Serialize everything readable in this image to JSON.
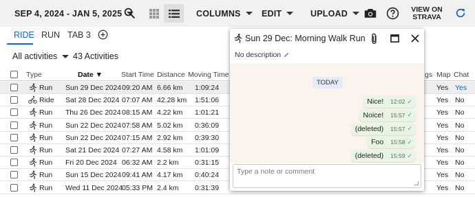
{
  "toolbar": {
    "date_range": "SEP 4, 2024 - JAN 5, 2025",
    "columns_label": "COLUMNS",
    "edit_label": "EDIT",
    "upload_label": "UPLOAD",
    "strava_line1": "VIEW ON",
    "strava_line2": "STRAVA"
  },
  "tabs": [
    "RIDE",
    "RUN",
    "TAB 3"
  ],
  "filter": {
    "activities_select": "All activities",
    "count_text": "43 Activities"
  },
  "table": {
    "headers": {
      "type": "Type",
      "date": "Date ▼",
      "start_time": "Start Time",
      "distance": "Distance",
      "moving_time": "Moving Time",
      "tags": "gs",
      "map": "Map",
      "chat": "Chat"
    },
    "rows": [
      {
        "type": "Run",
        "date": "Sun 29 Dec 2024",
        "start": "09:20 AM",
        "distance": "6.66 km",
        "moving": "1:09:24",
        "map": "Yes",
        "chat": "Yes"
      },
      {
        "type": "Ride",
        "date": "Sat 28 Dec 2024",
        "start": "07:07 AM",
        "distance": "42.28 km",
        "moving": "1:51:06",
        "map": "Yes",
        "chat": "No"
      },
      {
        "type": "Run",
        "date": "Thu 26 Dec 2024",
        "start": "08:15 AM",
        "distance": "4.22 km",
        "moving": "1:01:21",
        "map": "Yes",
        "chat": "No"
      },
      {
        "type": "Run",
        "date": "Sun 22 Dec 2024",
        "start": "07:58 AM",
        "distance": "5.02 km",
        "moving": "0:36:09",
        "map": "Yes",
        "chat": "No"
      },
      {
        "type": "Run",
        "date": "Sun 22 Dec 2024",
        "start": "07:15 AM",
        "distance": "2.92 km",
        "moving": "0:39:30",
        "map": "Yes",
        "chat": "No"
      },
      {
        "type": "Run",
        "date": "Sat 21 Dec 2024",
        "start": "07:27 AM",
        "distance": "4.58 km",
        "moving": "1:01:09",
        "map": "Yes",
        "chat": "No"
      },
      {
        "type": "Run",
        "date": "Fri 20 Dec 2024",
        "start": "06:32 AM",
        "distance": "2.2 km",
        "moving": "0:31:15",
        "map": "Yes",
        "chat": "No"
      },
      {
        "type": "Run",
        "date": "Sun 15 Dec 2024",
        "start": "09:41 AM",
        "distance": "4.17 km",
        "moving": "0:40:24",
        "map": "Yes",
        "chat": "No"
      },
      {
        "type": "Run",
        "date": "Wed 11 Dec 2024",
        "start": "05:33 PM",
        "distance": "2.4 km",
        "moving": "0:31:39",
        "map": "Yes",
        "chat": "No"
      }
    ]
  },
  "popup": {
    "title": "Sun 29 Dec: Morning Walk Run",
    "description": "No description",
    "date_chip": "TODAY",
    "messages": [
      {
        "text": "Nice!",
        "time": "12:02"
      },
      {
        "text": "Noice!",
        "time": "15:57"
      },
      {
        "text": "(deleted)",
        "time": "15:57"
      },
      {
        "text": "Foo",
        "time": "15:58"
      },
      {
        "text": "(deleted)",
        "time": "15:59"
      }
    ],
    "note_placeholder": "Type a note or comment"
  },
  "colors": {
    "accent": "#1565c0",
    "chat_bg": "#fbf3ee",
    "bubble": "#e8f5e3"
  }
}
